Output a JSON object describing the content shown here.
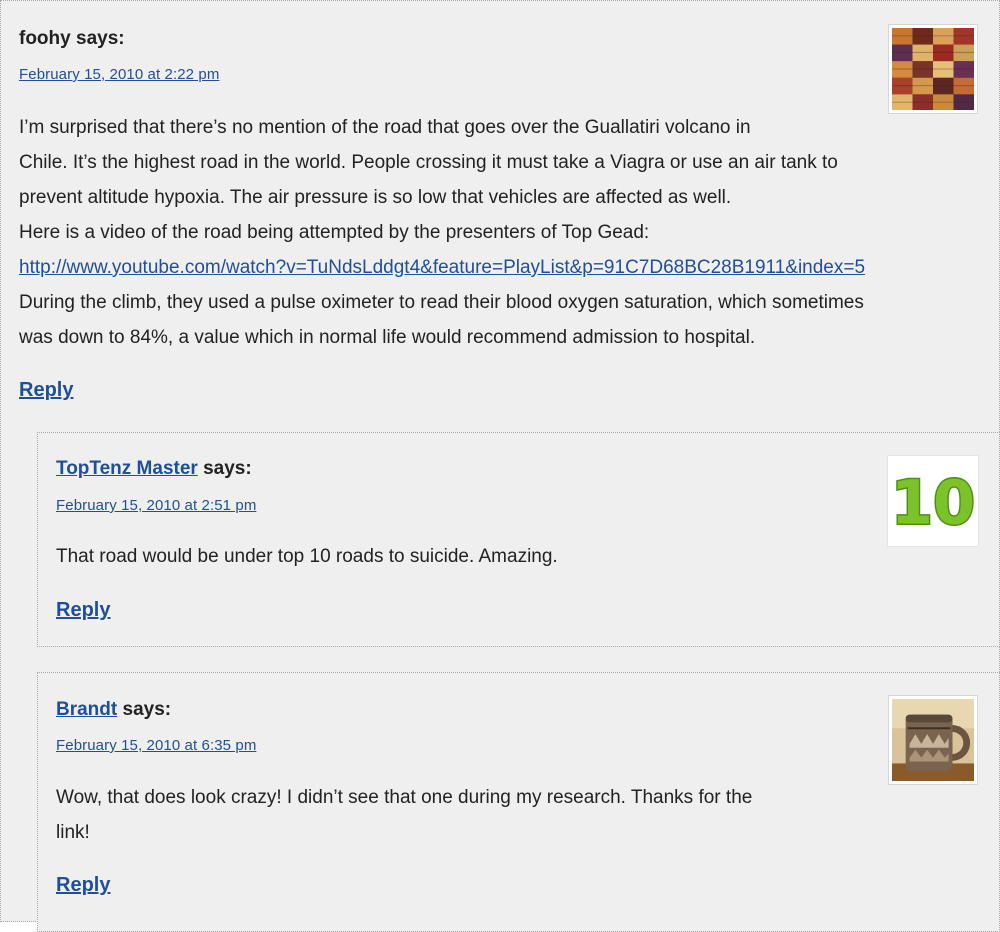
{
  "comments": [
    {
      "author": "foohy",
      "says": " says:",
      "date": "February 15, 2010 at 2:22 pm",
      "lines": [
        "I’m surprised that there’s no mention of the road that goes over the Guallatiri volcano in",
        "Chile. It’s the highest road in the world. People crossing it must take a Viagra or use an air tank to",
        "prevent altitude hypoxia. The air pressure is so low that vehicles are affected as well.",
        "Here is a video of the road being attempted by the presenters of Top Gead:",
        "http://www.youtube.com/watch?v=TuNdsLddgt4&feature=PlayList&p=91C7D68BC28B1911&index=5",
        "During the climb, they used a pulse oximeter to read their blood oxygen saturation, which sometimes",
        "was down to 84%, a value which in normal life would recommend admission to hospital."
      ],
      "reply": "Reply",
      "avatar": "woven-textile-avatar"
    },
    {
      "author": "TopTenz Master",
      "says": " says:",
      "date": "February 15, 2010 at 2:51 pm",
      "lines": [
        "That road would be under top 10 roads to suicide. Amazing."
      ],
      "reply": "Reply",
      "avatar": "toptenz-10-logo",
      "avatar_text": "10"
    },
    {
      "author": "Brandt",
      "says": " says:",
      "date": "February 15, 2010 at 6:35 pm",
      "lines": [
        "Wow, that does look crazy! I didn’t see that one during my research. Thanks for the",
        "link!"
      ],
      "reply": "Reply",
      "avatar": "ceramic-mug-avatar"
    }
  ],
  "colors": {
    "link": "#1f4e9c",
    "text": "#222222",
    "comment_bg": "#efefef",
    "dotted_border": "#a8a8a8",
    "toptenz_green": "#7cc22a"
  }
}
